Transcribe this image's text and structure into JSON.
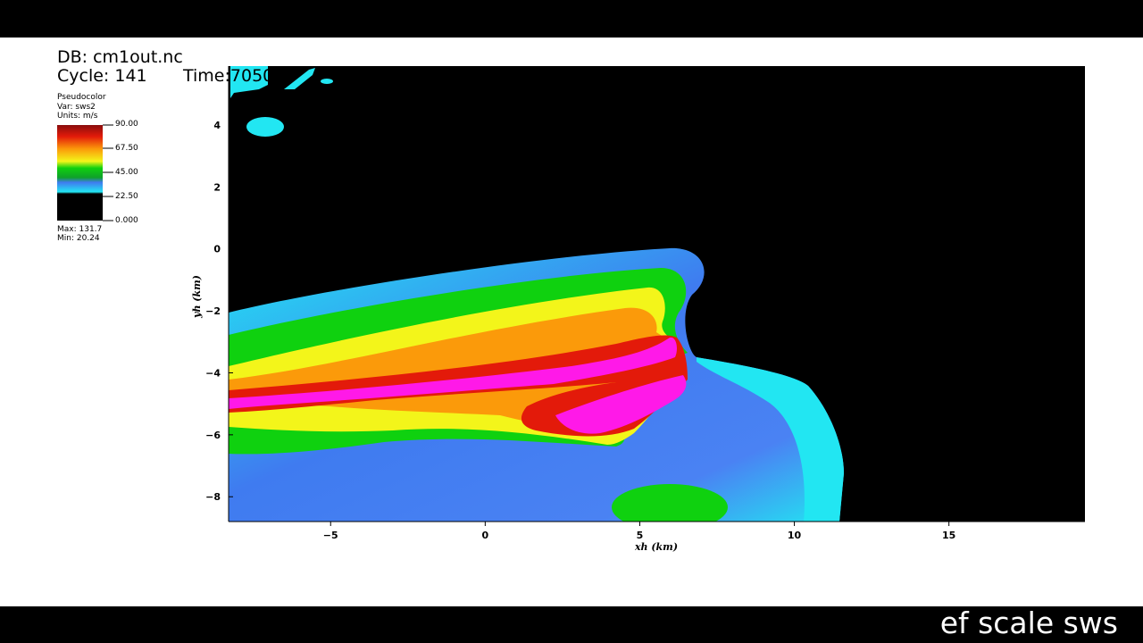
{
  "header": {
    "db_label": "DB: cm1out.nc",
    "cycle_label": "Cycle: 141",
    "time_label": "Time:7050"
  },
  "legend": {
    "plot_type": "Pseudocolor",
    "var_label": "Var: sws2",
    "units_label": "Units: m/s",
    "ticks": [
      "90.00",
      "67.50",
      "45.00",
      "22.50",
      "0.000"
    ],
    "max_label": "Max:  131.7",
    "min_label": "Min:  20.24"
  },
  "caption": "ef scale sws",
  "colors": {
    "background": "#000000",
    "cyan": "#22e6f2",
    "blue": "#3f7bf0",
    "green": "#0fd10f",
    "yellow": "#f3f51a",
    "orange": "#fb9a0a",
    "red": "#e31a0a",
    "dark_red": "#b30e0e",
    "magenta": "#ff19e8"
  },
  "chart_data": {
    "type": "heatmap",
    "variable": "sws2",
    "units": "m/s",
    "xlabel": "xh (km)",
    "ylabel": "yh (km)",
    "xlim": [
      -8.3,
      19.4
    ],
    "ylim": [
      -8.8,
      5.9
    ],
    "x_ticks": [
      -5,
      0,
      5,
      10,
      15
    ],
    "y_ticks": [
      -8,
      -6,
      -4,
      -2,
      0,
      2,
      4
    ],
    "colorbar_range": [
      0,
      90
    ],
    "data_max": 131.7,
    "data_min": 20.24
  }
}
